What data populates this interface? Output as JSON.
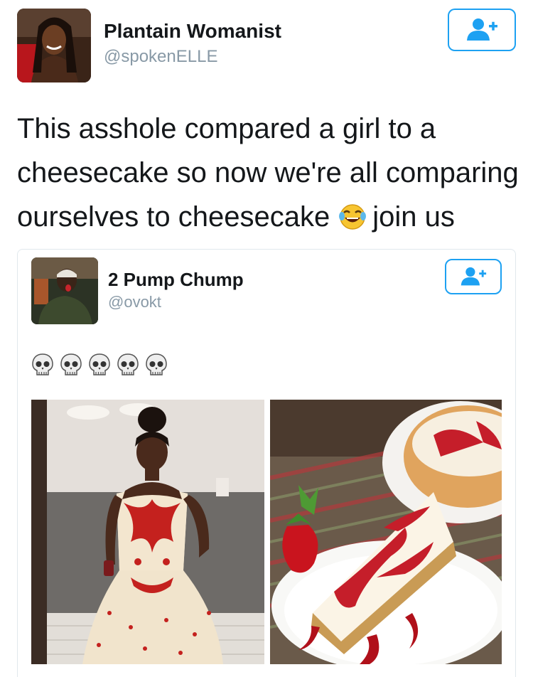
{
  "tweet": {
    "author": {
      "name": "Plantain Womanist",
      "handle": "@spokenELLE"
    },
    "follow_icon": "add-user-icon",
    "text_lines": [
      "This asshole compared a girl to a",
      "cheesecake so now we're all comparing",
      "ourselves to cheesecake"
    ],
    "text_end": "join us",
    "inline_emoji": "face-with-tears-of-joy-icon"
  },
  "quoted_tweet": {
    "author": {
      "name": "2 Pump Chump",
      "handle": "@ovokt"
    },
    "follow_icon": "add-user-icon",
    "emoji_row": [
      "skull-icon",
      "skull-icon",
      "skull-icon",
      "skull-icon",
      "skull-icon"
    ],
    "photos": [
      "woman-in-red-and-white-gown-photo",
      "strawberry-swirl-cheesecake-photo"
    ]
  },
  "colors": {
    "accent": "#1da1f2",
    "text": "#14171a",
    "muted": "#8899a6",
    "border": "#e1e8ed"
  }
}
